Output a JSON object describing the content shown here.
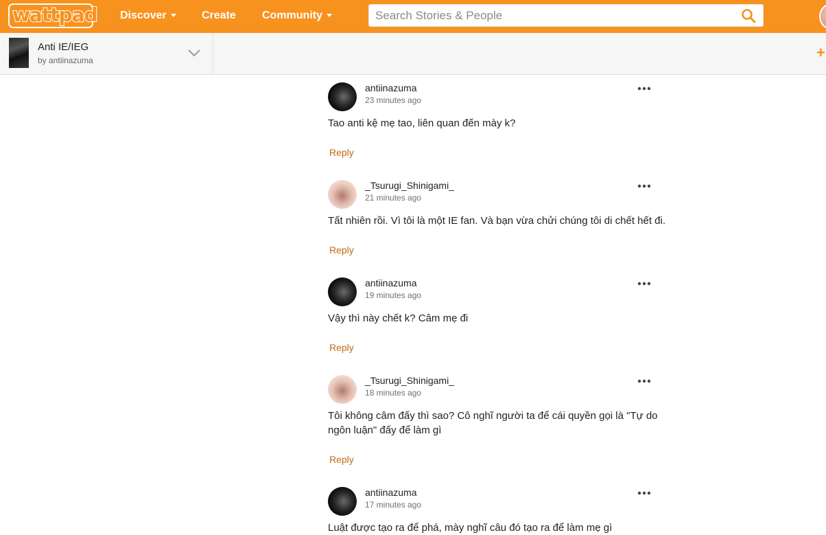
{
  "nav": {
    "logo": "wattpad",
    "discover": "Discover",
    "create": "Create",
    "community": "Community",
    "search_placeholder": "Search Stories & People"
  },
  "story": {
    "title": "Anti IE/IEG",
    "author": "by antiinazuma"
  },
  "colors": {
    "brand": "#f7921e",
    "reply": "#c26a13"
  },
  "comments": [
    {
      "user": "antiinazuma",
      "time": "23 minutes ago",
      "text": "Tao anti kệ mẹ tao, liên quan đến mày k?",
      "reply": "Reply",
      "avatar": "dark"
    },
    {
      "user": "_Tsurugi_Shinigami_",
      "time": "21 minutes ago",
      "text": "Tất nhiên rồi. Vì tôi là một IE fan. Và bạn vừa chửi chúng tôi di chết hết đi.",
      "reply": "Reply",
      "avatar": "pink"
    },
    {
      "user": "antiinazuma",
      "time": "19 minutes ago",
      "text": "Vậy thì này chết k? Câm mẹ đi",
      "reply": "Reply",
      "avatar": "dark"
    },
    {
      "user": "_Tsurugi_Shinigami_",
      "time": "18 minutes ago",
      "text": "Tôi không câm đấy thì sao? Cô nghĩ người ta để cái quyền gọi là \"Tự do ngôn luận\" đấy để làm gì",
      "reply": "Reply",
      "avatar": "pink"
    },
    {
      "user": "antiinazuma",
      "time": "17 minutes ago",
      "text": "Luật được tạo ra để phá, mày nghĩ câu đó tạo ra để làm mẹ gì",
      "reply": "",
      "avatar": "dark"
    }
  ]
}
